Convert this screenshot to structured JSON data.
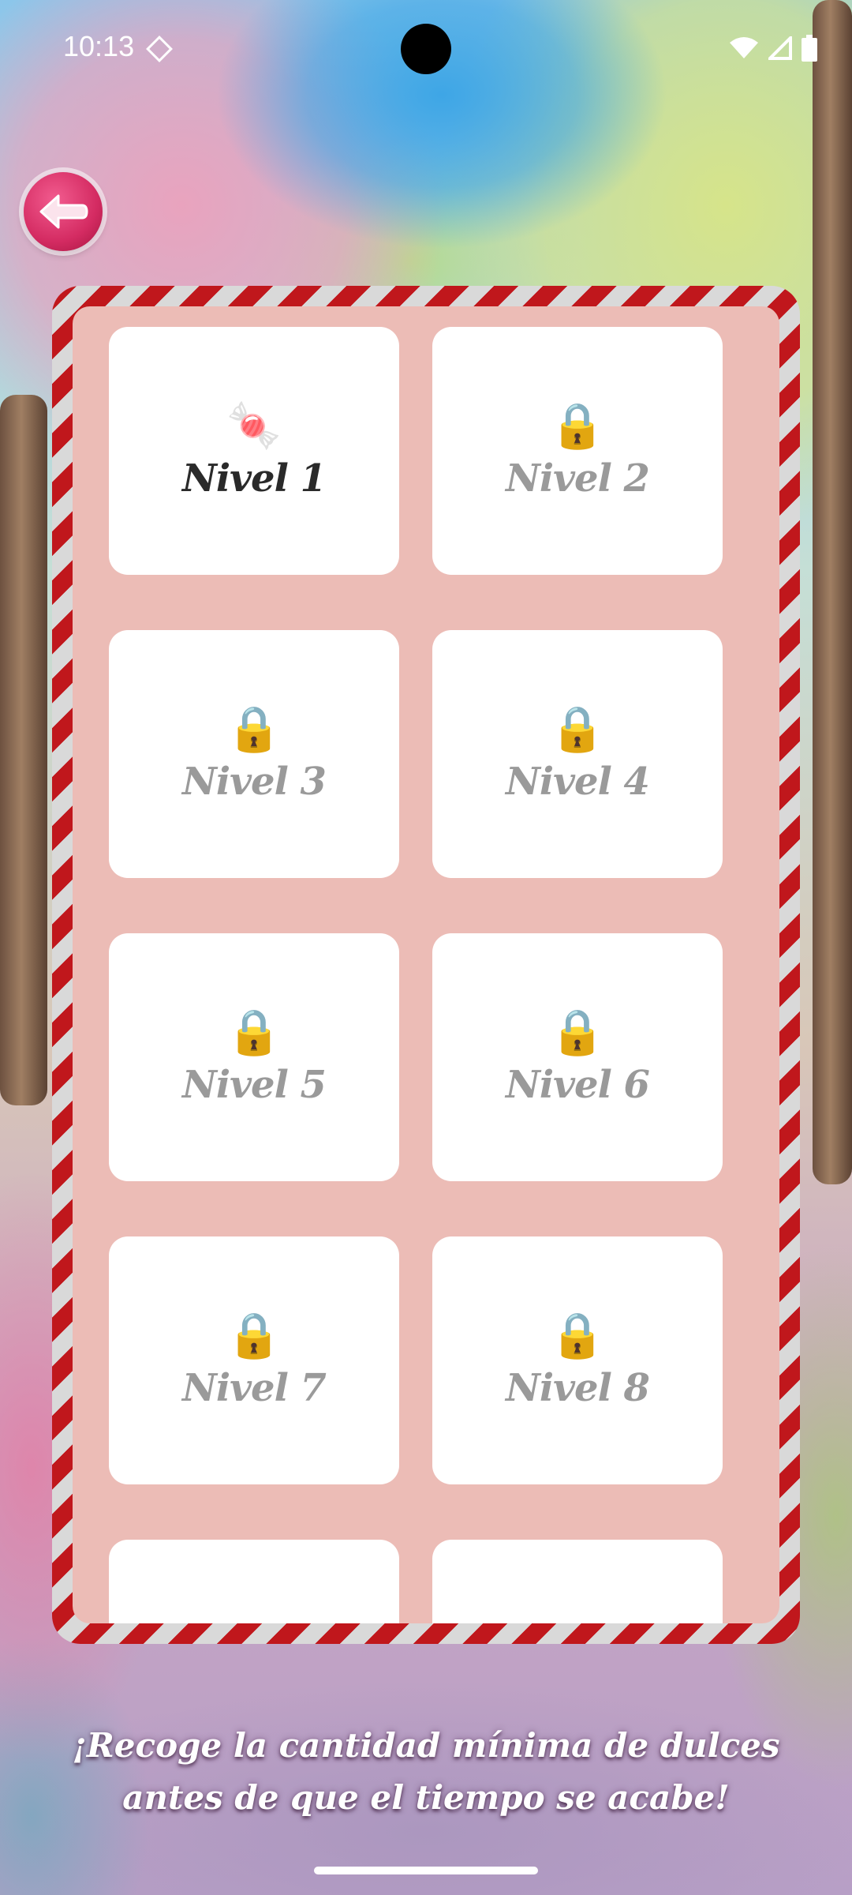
{
  "status_bar": {
    "time": "10:13"
  },
  "icons": {
    "back": "arrow-left-icon",
    "unlocked": "candy-icon",
    "locked": "lock-icon",
    "wifi": "wifi-icon",
    "signal": "signal-icon",
    "battery": "battery-icon"
  },
  "colors": {
    "frame_red": "#c0171c",
    "frame_white": "#d9d9d9",
    "panel_bg": "#ecbcb6",
    "back_button": "#d42b62",
    "locked_text": "#9a9a9a",
    "unlocked_text": "#2a2a2a"
  },
  "levels": [
    {
      "label": "Nivel 1",
      "locked": false,
      "icon": "🍬"
    },
    {
      "label": "Nivel 2",
      "locked": true,
      "icon": "🔒"
    },
    {
      "label": "Nivel 3",
      "locked": true,
      "icon": "🔒"
    },
    {
      "label": "Nivel 4",
      "locked": true,
      "icon": "🔒"
    },
    {
      "label": "Nivel 5",
      "locked": true,
      "icon": "🔒"
    },
    {
      "label": "Nivel 6",
      "locked": true,
      "icon": "🔒"
    },
    {
      "label": "Nivel 7",
      "locked": true,
      "icon": "🔒"
    },
    {
      "label": "Nivel 8",
      "locked": true,
      "icon": "🔒"
    }
  ],
  "footer": {
    "message": "¡Recoge la cantidad mínima de dulces antes de que el tiempo se acabe!"
  }
}
